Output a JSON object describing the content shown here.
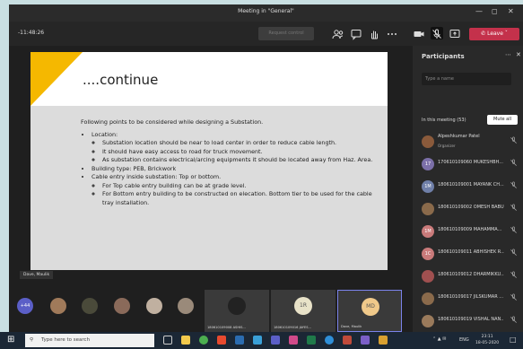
{
  "window": {
    "title": "Meeting in \"General\""
  },
  "toolbar": {
    "timer": "-11:48:26",
    "request_control": "Request control",
    "leave": "Leave"
  },
  "slide": {
    "title": "....continue",
    "intro": "Following points to be considered while designing a Substation.",
    "bullets": [
      {
        "text": "Location:",
        "sub": [
          "Substation location should be near to load center in order to reduce cable length.",
          "It should have easy access to road for truck movement.",
          "As substation contains electrical/arcing equipments it should be located away from Haz. Area."
        ]
      },
      {
        "text": "Building type: PEB, Brickwork",
        "sub": []
      },
      {
        "text": "Cable entry inside substation: Top or bottom.",
        "sub": [
          "For Top cable entry building can be at grade level.",
          "For Bottom entry building to be constructed on elecation. Bottom tier to be used for the cable tray installation."
        ]
      }
    ]
  },
  "presenter_tag": "Dave, Maulik",
  "panel": {
    "title": "Participants",
    "search_placeholder": "Type a name",
    "in_meeting": "In this meeting (53)",
    "mute_all": "Mute all",
    "participants": [
      {
        "initials": "",
        "name": "Alpeshkumar Patel",
        "sub": "Organizer",
        "color": "#8a5a3b"
      },
      {
        "initials": "17",
        "name": "170610109060 MUKESHBH...",
        "sub": "",
        "color": "#7b6fa8"
      },
      {
        "initials": "1M",
        "name": "180610109001 MAYANK CH...",
        "sub": "",
        "color": "#6f7fa8"
      },
      {
        "initials": "",
        "name": "180610109002 OMESH BABU",
        "sub": "",
        "color": "#8a6a4b"
      },
      {
        "initials": "1M",
        "name": "180610109009 MAHAMMA...",
        "sub": "",
        "color": "#c97a7a"
      },
      {
        "initials": "1C",
        "name": "180610109011 ABHISHEK R...",
        "sub": "",
        "color": "#c97a7a"
      },
      {
        "initials": "",
        "name": "180610109012 DHARMIKKU...",
        "sub": "",
        "color": "#a05050"
      },
      {
        "initials": "",
        "name": "180610109017 JILSKUMAR ...",
        "sub": "",
        "color": "#8a6a4b"
      },
      {
        "initials": "",
        "name": "180610109019 VISHAL NAN...",
        "sub": "",
        "color": "#9a7a5b"
      }
    ]
  },
  "strip": {
    "overflow": "+44",
    "tiles": [
      {
        "caption": "180610109008 ASHIS...",
        "initials": "",
        "color": "#222"
      },
      {
        "caption": "180610109016 JAYES...",
        "initials": "1R",
        "color": "#e8e2c8"
      },
      {
        "caption": "Dave, Maulik",
        "initials": "MD",
        "color": "#f0c98a"
      }
    ]
  },
  "taskbar": {
    "search_placeholder": "Type here to search",
    "lang": "ENG",
    "time": "23:11",
    "date": "18-05-2020"
  }
}
